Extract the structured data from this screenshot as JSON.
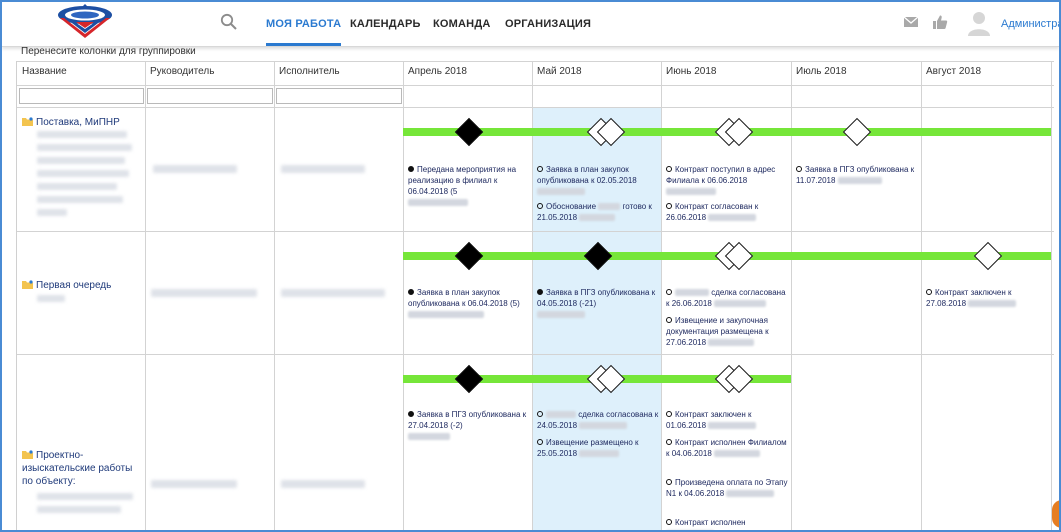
{
  "header": {
    "nav": [
      {
        "label": "МОЯ РАБОТА",
        "active": true
      },
      {
        "label": "КАЛЕНДАРЬ",
        "active": false
      },
      {
        "label": "КОМАНДА",
        "active": false
      },
      {
        "label": "ОРГАНИЗАЦИЯ",
        "active": false
      }
    ],
    "user_label": "Администра",
    "icons": [
      "logo-emblem",
      "search-icon",
      "mail-icon",
      "thumbs-up-icon",
      "avatar-icon"
    ]
  },
  "grid": {
    "group_hint": "Перенесите колонки для группировки",
    "columns": [
      "Название",
      "Руководитель",
      "Исполнитель",
      "Апрель 2018",
      "Май 2018",
      "Июнь 2018",
      "Июль 2018",
      "Август 2018"
    ],
    "highlight_column": "Май 2018",
    "colors": {
      "bar": "#76e639",
      "highlight": "#def0fb",
      "accent": "#2b7ad0"
    },
    "rows": [
      {
        "name": "Поставка, МиПНР",
        "milestones": [
          "filled",
          "open-double",
          "open-double",
          "open"
        ],
        "events": {
          "apr": [
            {
              "marker": "filled",
              "text": "Передана мероприятия на реализацию в филиал к 06.04.2018 (5"
            }
          ],
          "may": [
            {
              "marker": "open",
              "text": "Заявка в план закупок опубликована к 02.05.2018"
            },
            {
              "marker": "open",
              "text": "Обоснование",
              "text2": "готово к 21.05.2018"
            }
          ],
          "jun": [
            {
              "marker": "open",
              "text": "Контракт поступил в адрес Филиала к 06.06.2018"
            },
            {
              "marker": "open",
              "text": "Контракт согласован к 26.06.2018"
            }
          ],
          "jul": [
            {
              "marker": "open",
              "text": "Заявка в ПГЗ опубликована к 11.07.2018"
            }
          ]
        }
      },
      {
        "name": "Первая очередь",
        "milestones": [
          "filled",
          "filled",
          "open-double",
          "open"
        ],
        "events": {
          "apr": [
            {
              "marker": "filled",
              "text": "Заявка в план закупок опубликована к 06.04.2018 (5)"
            }
          ],
          "may": [
            {
              "marker": "filled",
              "text": "Заявка в ПГЗ опубликована к 04.05.2018 (-21)"
            }
          ],
          "jun": [
            {
              "marker": "open",
              "text": "сделка согласована к 26.06.2018"
            },
            {
              "marker": "open",
              "text": "Извещение и закупочная документация размещена к 27.06.2018"
            }
          ],
          "aug": [
            {
              "marker": "open",
              "text": "Контракт заключен к 27.08.2018"
            }
          ]
        }
      },
      {
        "name": "Проектно-изыскательские работы по объекту:",
        "milestones": [
          "filled",
          "open-double",
          "open-double"
        ],
        "events": {
          "apr": [
            {
              "marker": "filled",
              "text": "Заявка в ПГЗ опубликована к 27.04.2018 (-2)"
            }
          ],
          "may": [
            {
              "marker": "open",
              "text": "сделка согласована к 24.05.2018"
            },
            {
              "marker": "open",
              "text": "Извещение размещено к 25.05.2018"
            }
          ],
          "jun": [
            {
              "marker": "open",
              "text": "Контракт заключен к 01.06.2018"
            },
            {
              "marker": "open",
              "text": "Контракт исполнен Филиалом к 04.06.2018"
            },
            {
              "marker": "open",
              "text": "Произведена оплата по Этапу N1 к 04.06.2018"
            },
            {
              "marker": "open",
              "text": "Контракт исполнен"
            }
          ]
        }
      }
    ]
  }
}
